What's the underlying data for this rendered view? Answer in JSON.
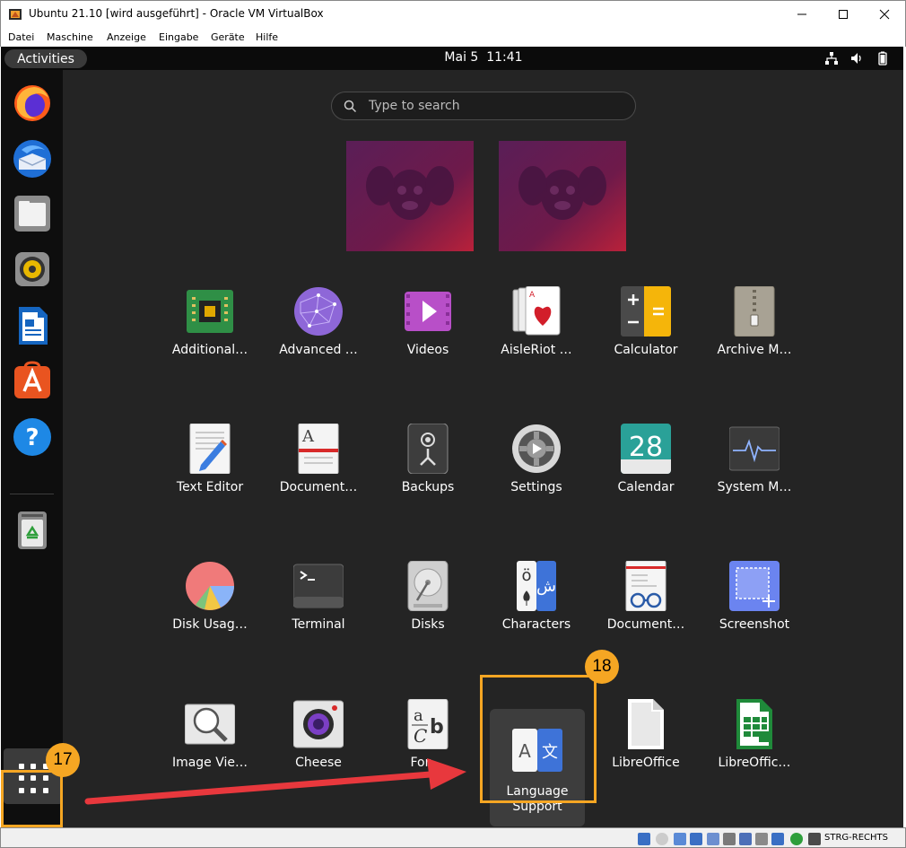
{
  "window": {
    "title": "Ubuntu 21.10 [wird ausgeführt] - Oracle VM VirtualBox"
  },
  "menubar": [
    "Datei",
    "Maschine",
    "Anzeige",
    "Eingabe",
    "Geräte",
    "Hilfe"
  ],
  "topbar": {
    "activities": "Activities",
    "clock": "Mai 5  11:41"
  },
  "dock": {
    "items": [
      "firefox-icon",
      "thunderbird-icon",
      "files-icon",
      "rhythmbox-icon",
      "libreoffice-writer-icon",
      "ubuntu-software-icon",
      "help-icon",
      "trash-icon"
    ]
  },
  "search": {
    "placeholder": "Type to search"
  },
  "apps": [
    {
      "label": "Additional…",
      "icon": "chip-icon"
    },
    {
      "label": "Advanced …",
      "icon": "network-sphere-icon"
    },
    {
      "label": "Videos",
      "icon": "video-play-icon"
    },
    {
      "label": "AisleRiot …",
      "icon": "playing-cards-icon"
    },
    {
      "label": "Calculator",
      "icon": "calculator-icon"
    },
    {
      "label": "Archive M…",
      "icon": "archive-icon"
    },
    {
      "label": "Text Editor",
      "icon": "text-editor-icon"
    },
    {
      "label": "Document…",
      "icon": "document-scanner-icon"
    },
    {
      "label": "Backups",
      "icon": "safe-icon"
    },
    {
      "label": "Settings",
      "icon": "gear-icon"
    },
    {
      "label": "Calendar",
      "icon": "calendar-icon"
    },
    {
      "label": "System M…",
      "icon": "system-monitor-icon"
    },
    {
      "label": "Disk Usag…",
      "icon": "pie-chart-icon"
    },
    {
      "label": "Terminal",
      "icon": "terminal-icon"
    },
    {
      "label": "Disks",
      "icon": "disk-icon"
    },
    {
      "label": "Characters",
      "icon": "characters-icon"
    },
    {
      "label": "Document…",
      "icon": "document-viewer-icon"
    },
    {
      "label": "Screenshot",
      "icon": "screenshot-icon"
    },
    {
      "label": "Image Vie…",
      "icon": "image-viewer-icon"
    },
    {
      "label": "Cheese",
      "icon": "camera-icon"
    },
    {
      "label": "Fon…",
      "icon": "fonts-icon"
    },
    {
      "label": "Language Support",
      "icon": "language-icon"
    },
    {
      "label": "LibreOffice",
      "icon": "libreoffice-icon"
    },
    {
      "label": "LibreOffic…",
      "icon": "libreoffice-calc-icon"
    }
  ],
  "calendar_day": "28",
  "characters_glyph": "ö",
  "characters_glyph2": "ش",
  "annotations": {
    "badge_17": "17",
    "badge_18": "18"
  },
  "statusbar": {
    "hostkey": "STRG-RECHTS"
  },
  "colors": {
    "accent": "#f5a623",
    "arrow": "#e8383d",
    "overview_bg": "#242424"
  }
}
